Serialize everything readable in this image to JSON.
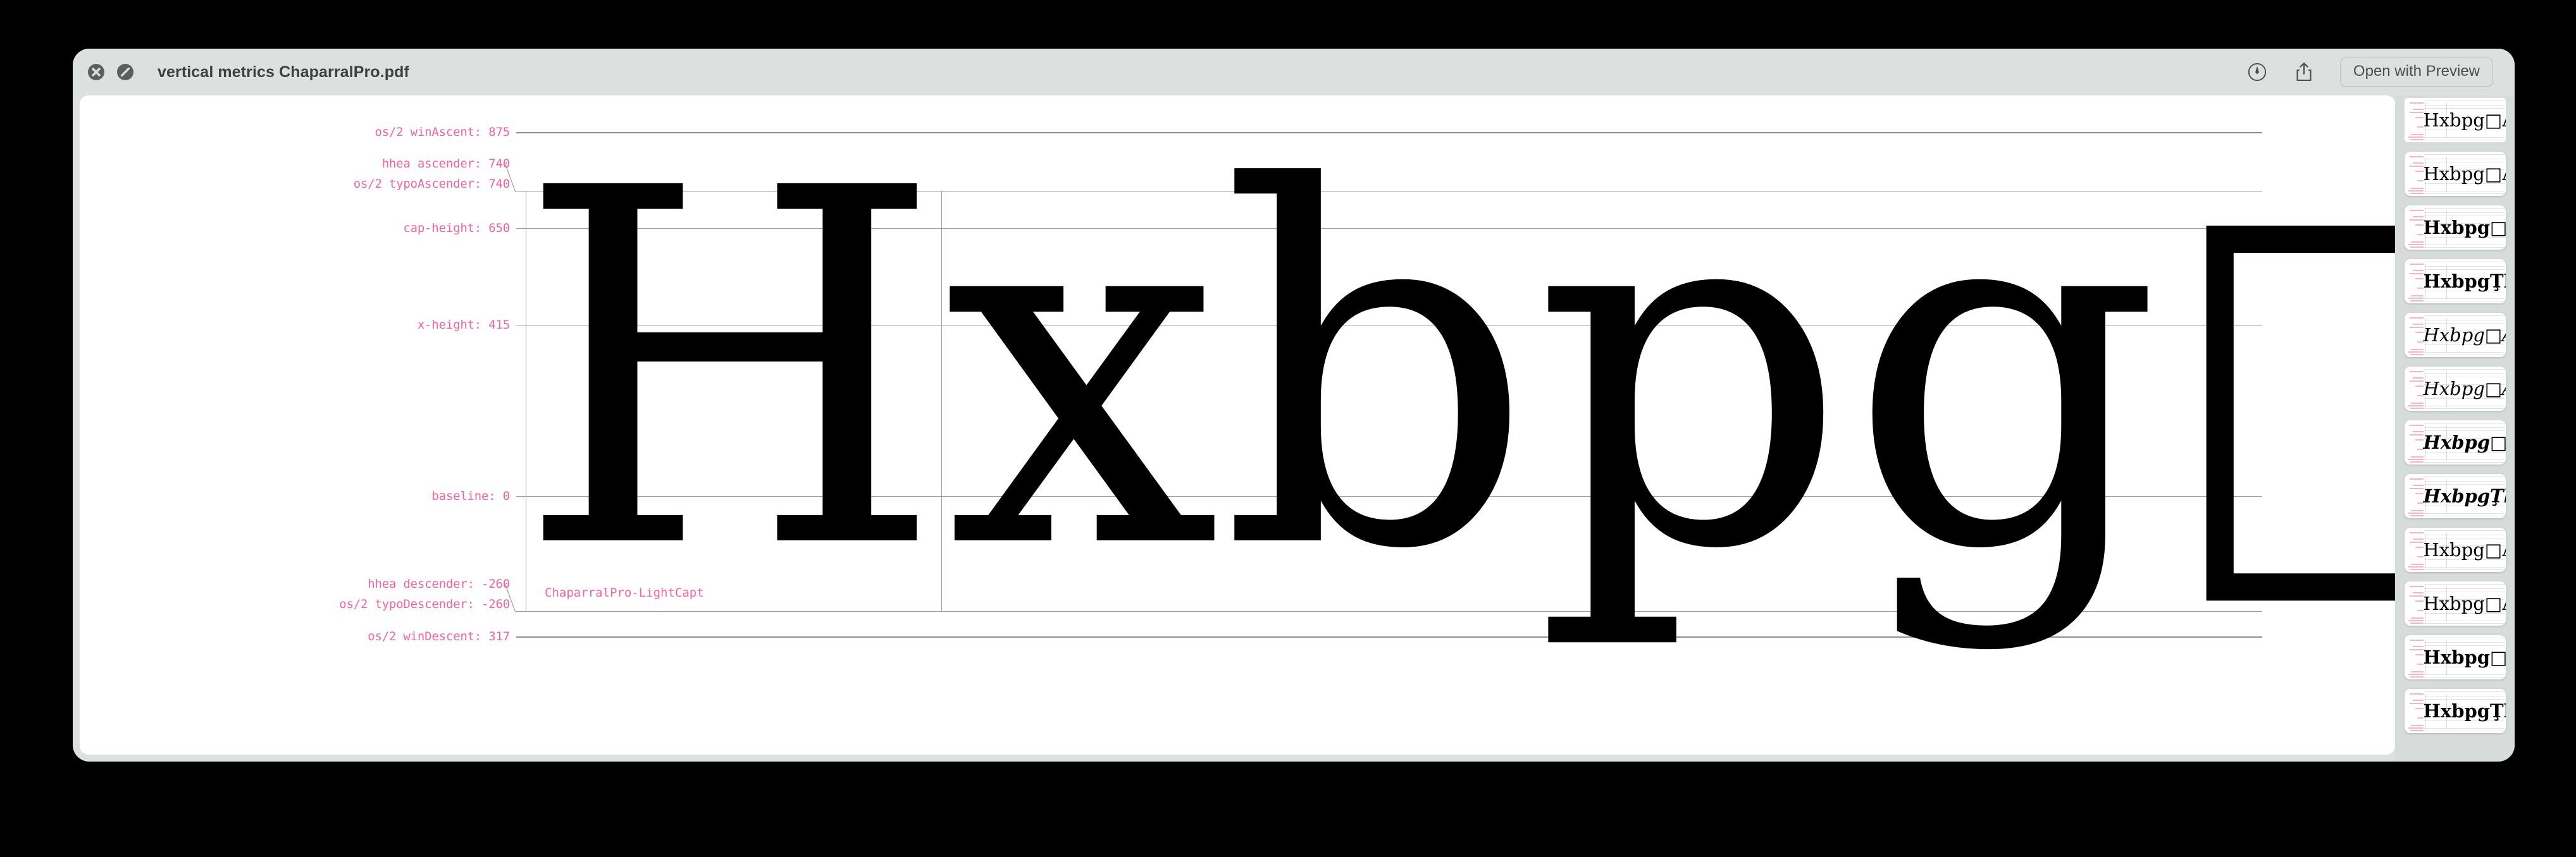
{
  "window": {
    "title": "vertical metrics ChaparralPro.pdf",
    "close_icon": "close-circle-icon",
    "block_icon": "no-entry-circle-icon",
    "markup_icon": "markup-pen-icon",
    "share_icon": "share-icon",
    "open_with_label": "Open with Preview"
  },
  "document": {
    "font_name": "ChaparralPro-LightCapt",
    "specimen_text": "Hxbpg□Å",
    "accent_color": "#f2649e",
    "guide_color": "#9b9b9b",
    "metrics": [
      {
        "name": "os/2 winAscent",
        "value": 875,
        "label": "os/2 winAscent: 875"
      },
      {
        "name": "hhea ascender",
        "value": 740,
        "label": "hhea ascender: 740"
      },
      {
        "name": "os/2 typoAscender",
        "value": 740,
        "label": "os/2 typoAscender: 740"
      },
      {
        "name": "cap-height",
        "value": 650,
        "label": "cap-height: 650"
      },
      {
        "name": "x-height",
        "value": 415,
        "label": "x-height: 415"
      },
      {
        "name": "baseline",
        "value": 0,
        "label": "baseline: 0"
      },
      {
        "name": "hhea descender",
        "value": -260,
        "label": "hhea descender: -260"
      },
      {
        "name": "os/2 typoDescender",
        "value": -260,
        "label": "os/2 typoDescender: -260"
      },
      {
        "name": "os/2 winDescent",
        "value": 317,
        "label": "os/2 winDescent: 317"
      }
    ]
  },
  "sidebar": {
    "thumbnails": [
      {
        "text": "Hxbpg□Å",
        "style": "regular",
        "selected": true
      },
      {
        "text": "Hxbpg□Å",
        "style": "regular",
        "selected": false
      },
      {
        "text": "Hxbpg□Å",
        "style": "bold",
        "selected": false
      },
      {
        "text": "HxbpgŢhÅ",
        "style": "bold",
        "selected": false
      },
      {
        "text": "Hxbpg□Å",
        "style": "italic",
        "selected": false
      },
      {
        "text": "Hxbpg□Å",
        "style": "italic",
        "selected": false
      },
      {
        "text": "Hxbpg□Å",
        "style": "bolditalic",
        "selected": false
      },
      {
        "text": "HxbpgŢhÍ",
        "style": "bolditalic",
        "selected": false
      },
      {
        "text": "Hxbpg□Å",
        "style": "regular",
        "selected": false
      },
      {
        "text": "Hxbpg□Å",
        "style": "regular",
        "selected": false
      },
      {
        "text": "Hxbpg□Å",
        "style": "bold",
        "selected": false
      },
      {
        "text": "HxbpgŢhÅ",
        "style": "bold",
        "selected": false
      }
    ]
  }
}
